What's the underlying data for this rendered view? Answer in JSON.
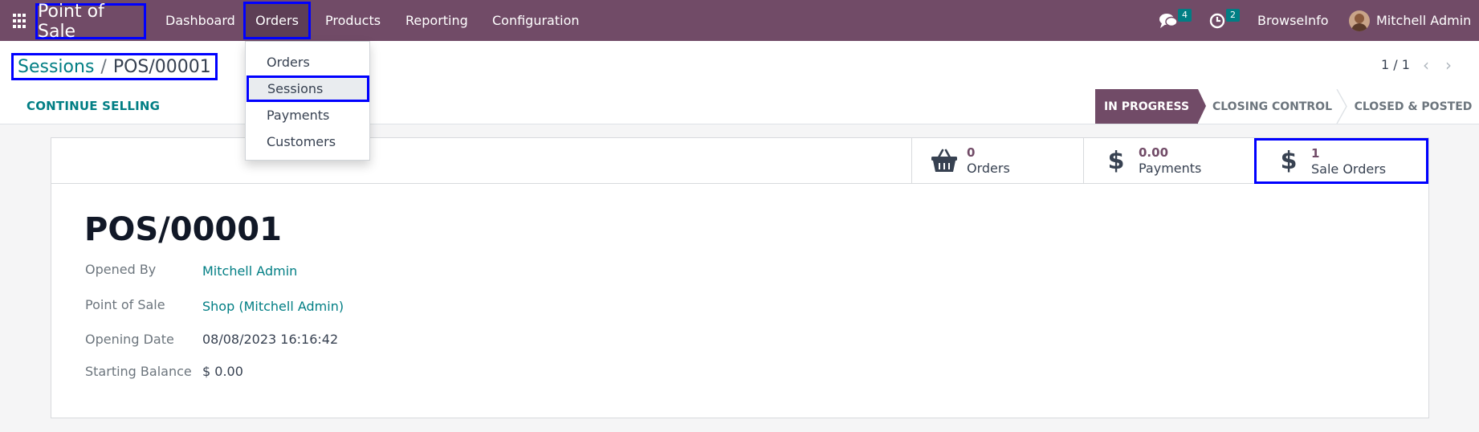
{
  "navbar": {
    "brand": "Point of Sale",
    "menu": [
      "Dashboard",
      "Orders",
      "Products",
      "Reporting",
      "Configuration"
    ],
    "messages_count": "4",
    "activities_count": "2",
    "company": "BrowseInfo",
    "user": "Mitchell Admin"
  },
  "dropdown": {
    "items": [
      "Orders",
      "Sessions",
      "Payments",
      "Customers"
    ]
  },
  "breadcrumb": {
    "parent": "Sessions",
    "separator": "/",
    "current": "POS/00001"
  },
  "pager": {
    "value": "1 / 1",
    "prev": "‹",
    "next": "›"
  },
  "actions": {
    "continue_selling": "CONTINUE SELLING"
  },
  "status": {
    "stages": [
      "IN PROGRESS",
      "CLOSING CONTROL",
      "CLOSED & POSTED"
    ],
    "active": "IN PROGRESS"
  },
  "smart_buttons": [
    {
      "value": "0",
      "label": "Orders",
      "icon": "basket-icon"
    },
    {
      "value": "0.00",
      "label": "Payments",
      "icon": "dollar-icon"
    },
    {
      "value": "1",
      "label": "Sale Orders",
      "icon": "dollar-icon"
    }
  ],
  "record": {
    "title": "POS/00001",
    "fields": [
      {
        "label": "Opened By",
        "value": "Mitchell Admin"
      },
      {
        "label": "Point of Sale",
        "value": "Shop (Mitchell Admin)"
      },
      {
        "label": "Opening Date",
        "value": "08/08/2023 16:16:42"
      },
      {
        "label": "Starting Balance",
        "value": "$ 0.00"
      }
    ]
  },
  "colors": {
    "brand": "#714b67",
    "link": "#017e84",
    "highlight": "#0000ff"
  }
}
